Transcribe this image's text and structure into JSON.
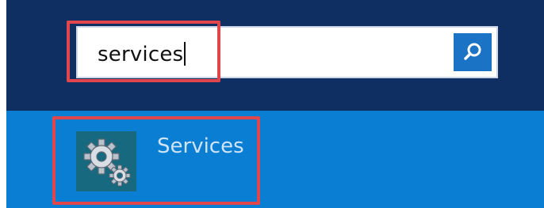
{
  "search": {
    "query": "services",
    "button_icon": "search-icon"
  },
  "results": [
    {
      "label": "Services",
      "icon": "gear-icon"
    }
  ],
  "colors": {
    "search_background": "#0f2f63",
    "results_background": "#0a7ed2",
    "search_button": "#1a73c4",
    "app_tile": "#16697e",
    "highlight": "#e0464c"
  }
}
